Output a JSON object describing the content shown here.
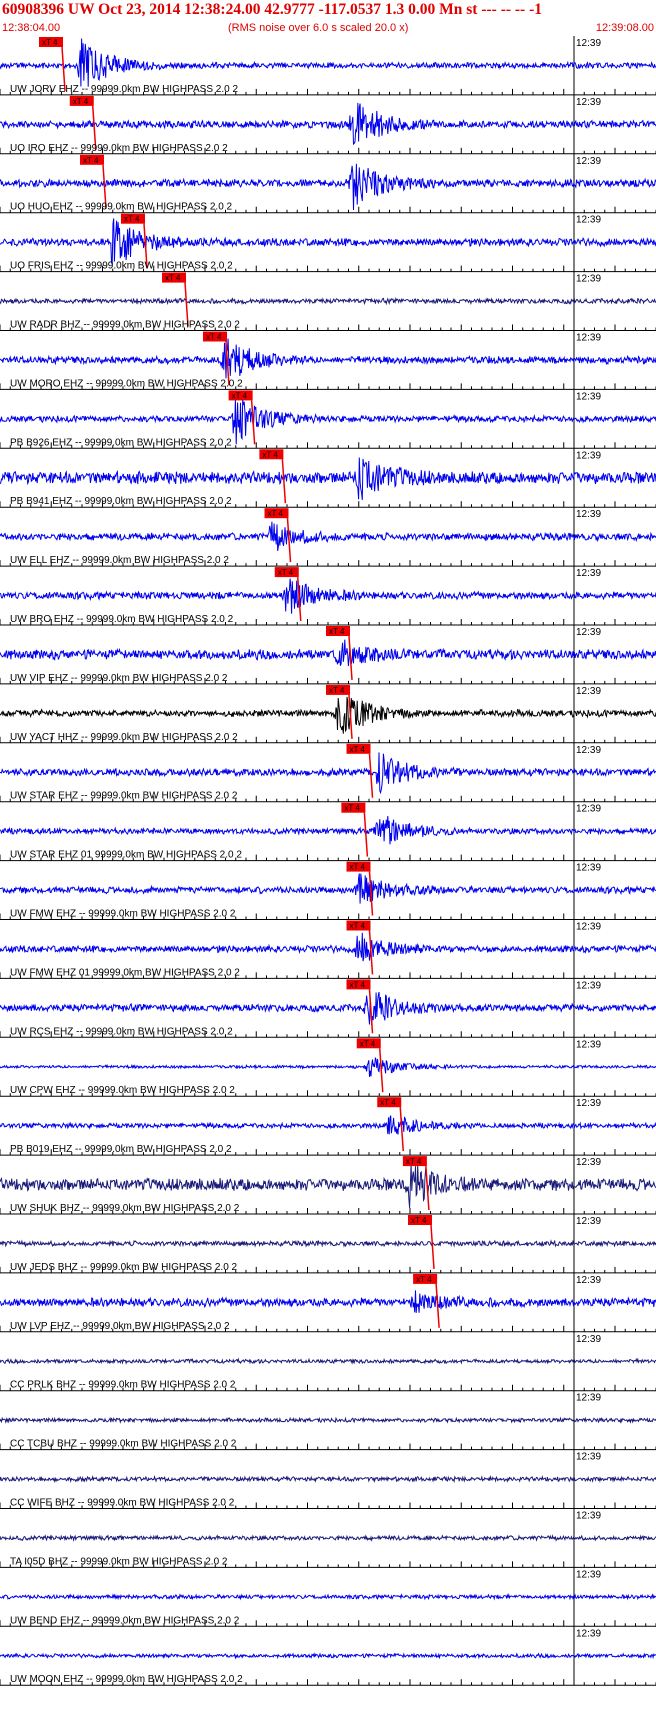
{
  "header": {
    "title": "60908396 UW Oct 23, 2014 12:38:24.00   42.9777 -117.0537  1.3 0.00 Mn st --- -- --  -1",
    "start_time": "12:38:04.00",
    "scaling_note": "(RMS noise over 6.0 s scaled 20.0 x)",
    "end_time": "12:39:08.00"
  },
  "colors": {
    "header_text": "#e00000",
    "trace_blue": "#0000ee",
    "trace_navy": "#1a1a7a",
    "trace_black": "#000000",
    "pick_red": "#ee0000",
    "grid": "#000000"
  },
  "chart_data": {
    "type": "seismogram",
    "time_range": [
      "12:38:04.00",
      "12:39:08.00"
    ],
    "minute_mark_label": "12:39",
    "minute_mark_time": "12:39:00.00",
    "pick_label": "xT 4",
    "tick_interval_s": 1,
    "traces": [
      {
        "label": "UW JORV EHZ -- 99999.0km BW  HIGHPASS  2.0  2",
        "color": "#0000ee",
        "pick_s": 4.0,
        "burst_s": 8.0,
        "burst_amp": 1.0,
        "noise": 0.12
      },
      {
        "label": "UO IRO EHZ -- 99999.0km BW  HIGHPASS  2.0  2",
        "color": "#0000ee",
        "pick_s": 7.0,
        "burst_s": 34.5,
        "burst_amp": 0.9,
        "noise": 0.15
      },
      {
        "label": "UO HUO EHZ -- 99999.0km BW  HIGHPASS  2.0  2",
        "color": "#0000ee",
        "pick_s": 8.0,
        "burst_s": 34.5,
        "burst_amp": 0.9,
        "noise": 0.16
      },
      {
        "label": "UO FRIS EHZ -- 99999.0km BW  HIGHPASS  2.0  2",
        "color": "#0000ee",
        "pick_s": 12.0,
        "burst_s": 11.0,
        "burst_amp": 0.9,
        "noise": 0.16
      },
      {
        "label": "UW RADR BHZ -- 99999.0km BW  HIGHPASS  2.0  2",
        "color": "#1a1a7a",
        "pick_s": 16.0,
        "burst_s": 0,
        "burst_amp": 0,
        "noise": 0.1
      },
      {
        "label": "UW MORO EHZ -- 99999.0km BW  HIGHPASS  2.0  2",
        "color": "#0000ee",
        "pick_s": 20.0,
        "burst_s": 22.0,
        "burst_amp": 1.0,
        "noise": 0.15
      },
      {
        "label": "PB B926 EHZ -- 99999.0km BW  HIGHPASS  2.0  2",
        "color": "#0000ee",
        "pick_s": 22.5,
        "burst_s": 23.0,
        "burst_amp": 0.9,
        "noise": 0.13
      },
      {
        "label": "PB B941 EHZ -- 99999.0km BW  HIGHPASS  2.0  2",
        "color": "#0000ee",
        "pick_s": 25.5,
        "burst_s": 35.0,
        "burst_amp": 0.8,
        "noise": 0.25
      },
      {
        "label": "UW ELL EHZ -- 99999.0km BW  HIGHPASS  2.0  2",
        "color": "#0000ee",
        "pick_s": 26.0,
        "burst_s": 26.5,
        "burst_amp": 0.5,
        "noise": 0.15
      },
      {
        "label": "UW BRO EHZ -- 99999.0km BW  HIGHPASS  2.0  2",
        "color": "#0000ee",
        "pick_s": 27.0,
        "burst_s": 28.0,
        "burst_amp": 0.7,
        "noise": 0.15
      },
      {
        "label": "UW VIP EHZ -- 99999.0km BW  HIGHPASS  2.0  2",
        "color": "#0000ee",
        "pick_s": 32.0,
        "burst_s": 33.0,
        "burst_amp": 0.5,
        "noise": 0.2
      },
      {
        "label": "UW YACT HHZ -- 99999.0km BW  HIGHPASS  2.0  2",
        "color": "#000000",
        "pick_s": 32.0,
        "burst_s": 33.0,
        "burst_amp": 0.9,
        "noise": 0.14
      },
      {
        "label": "UW STAR EHZ -- 99999.0km BW  HIGHPASS  2.0  2",
        "color": "#0000ee",
        "pick_s": 34.0,
        "burst_s": 37.0,
        "burst_amp": 0.7,
        "noise": 0.15
      },
      {
        "label": "UW STAR EHZ 01 99999.0km BW  HIGHPASS  2.0  2",
        "color": "#0000ee",
        "pick_s": 33.5,
        "burst_s": 37.0,
        "burst_amp": 0.7,
        "noise": 0.12
      },
      {
        "label": "UW FMW EHZ -- 99999.0km BW  HIGHPASS  2.0  2",
        "color": "#0000ee",
        "pick_s": 34.0,
        "burst_s": 35.0,
        "burst_amp": 0.6,
        "noise": 0.14
      },
      {
        "label": "UW FMW EHZ 01 99999.0km BW  HIGHPASS  2.0  2",
        "color": "#0000ee",
        "pick_s": 34.0,
        "burst_s": 35.0,
        "burst_amp": 0.6,
        "noise": 0.14
      },
      {
        "label": "UW RCS EHZ -- 99999.0km BW  HIGHPASS  2.0  2",
        "color": "#0000ee",
        "pick_s": 34.0,
        "burst_s": 36.0,
        "burst_amp": 0.7,
        "noise": 0.15
      },
      {
        "label": "UW CPW EHZ -- 99999.0km BW  HIGHPASS  2.0  2",
        "color": "#0000ee",
        "pick_s": 35.0,
        "burst_s": 36.0,
        "burst_amp": 0.4,
        "noise": 0.06
      },
      {
        "label": "PB B019 EHZ -- 99999.0km BW  HIGHPASS  2.0  2",
        "color": "#0000ee",
        "pick_s": 37.0,
        "burst_s": 38.0,
        "burst_amp": 0.4,
        "noise": 0.1
      },
      {
        "label": "UW SHUK BHZ -- 99999.0km BW  HIGHPASS  2.0  2",
        "color": "#1a1a7a",
        "pick_s": 39.5,
        "burst_s": 40.0,
        "burst_amp": 0.8,
        "noise": 0.25
      },
      {
        "label": "UW JEDS BHZ -- 99999.0km BW  HIGHPASS  2.0  2",
        "color": "#1a1a7a",
        "pick_s": 40.0,
        "burst_s": 0,
        "burst_amp": 0,
        "noise": 0.1
      },
      {
        "label": "UW LVP EHZ -- 99999.0km BW  HIGHPASS  2.0  2",
        "color": "#0000ee",
        "pick_s": 40.5,
        "burst_s": 40.5,
        "burst_amp": 0.3,
        "noise": 0.18
      },
      {
        "label": "CC PRLK BHZ -- 99999.0km BW  HIGHPASS  2.0  2",
        "color": "#1a1a7a",
        "pick_s": null,
        "burst_s": 0,
        "burst_amp": 0,
        "noise": 0.08
      },
      {
        "label": "CC TCBU BHZ -- 99999.0km BW  HIGHPASS  2.0  2",
        "color": "#1a1a7a",
        "pick_s": null,
        "burst_s": 0,
        "burst_amp": 0,
        "noise": 0.08
      },
      {
        "label": "CC WIFE BHZ -- 99999.0km BW  HIGHPASS  2.0  2",
        "color": "#1a1a7a",
        "pick_s": null,
        "burst_s": 0,
        "burst_amp": 0,
        "noise": 0.09
      },
      {
        "label": "TA I05D BHZ -- 99999.0km BW  HIGHPASS  2.0  2",
        "color": "#1a1a7a",
        "pick_s": null,
        "burst_s": 0,
        "burst_amp": 0,
        "noise": 0.09
      },
      {
        "label": "UW BEND EHZ -- 99999.0km BW  HIGHPASS  2.0  2",
        "color": "#0000ee",
        "pick_s": null,
        "burst_s": 0,
        "burst_amp": 0,
        "noise": 0.08
      },
      {
        "label": "UW MOON EHZ -- 99999.0km BW  HIGHPASS  2.0  2",
        "color": "#0000ee",
        "pick_s": null,
        "burst_s": 0,
        "burst_amp": 0,
        "noise": 0.08
      }
    ]
  }
}
